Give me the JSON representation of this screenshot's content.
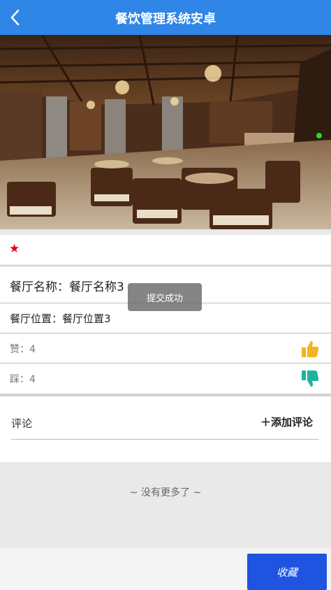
{
  "header": {
    "title": "餐饮管理系统安卓",
    "back_icon": "chevron-left-icon"
  },
  "hero": {
    "image": "restaurant-interior-photo"
  },
  "favorite": {
    "icon": "star-icon",
    "color": "#e60012"
  },
  "restaurant": {
    "name_label": "餐厅名称：",
    "name_value": "餐厅名称3",
    "location_label": "餐厅位置：",
    "location_value": "餐厅位置3"
  },
  "likes": {
    "label": "赞：",
    "count": "4",
    "icon": "thumbs-up-icon",
    "color": "#f3b323"
  },
  "dislikes": {
    "label": "踩：",
    "count": "4",
    "icon": "thumbs-down-icon",
    "color": "#1db3a1"
  },
  "comments": {
    "title": "评论",
    "add_label": "＋添加评论"
  },
  "footer_note": "~ 没有更多了 ~",
  "collect_button": {
    "label": "收藏"
  },
  "toast": {
    "text": "提交成功"
  },
  "colors": {
    "header": "#2f86e6",
    "button": "#1e54e0"
  }
}
